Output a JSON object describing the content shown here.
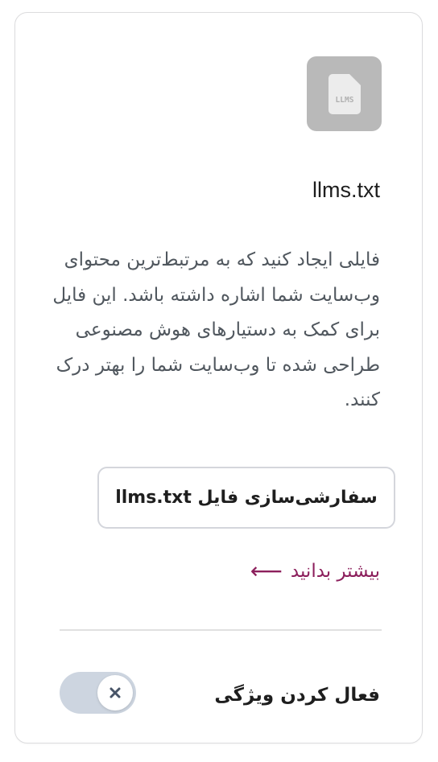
{
  "card": {
    "icon": {
      "name": "llms-file-icon",
      "text": "LLMS",
      "tile_color": "#b9b9b9"
    },
    "title": "llms.txt",
    "description": "فایلی ایجاد کنید که به مرتبط‌ترین محتوای وب‌سایت شما اشاره داشته باشد. این فایل برای کمک به دستیارهای هوش مصنوعی طراحی شده تا وب‌سایت شما را بهتر درک کنند.",
    "customize_button_label": "سفارشی‌سازی فایل llms.txt",
    "learn_more": {
      "label": "بیشتر بدانید",
      "arrow": "⟵",
      "color": "#8c1f5c"
    },
    "toggle": {
      "label": "فعال کردن ویژگی",
      "state": "off",
      "icon": "close-icon",
      "track_color": "#cdd5e0"
    }
  }
}
